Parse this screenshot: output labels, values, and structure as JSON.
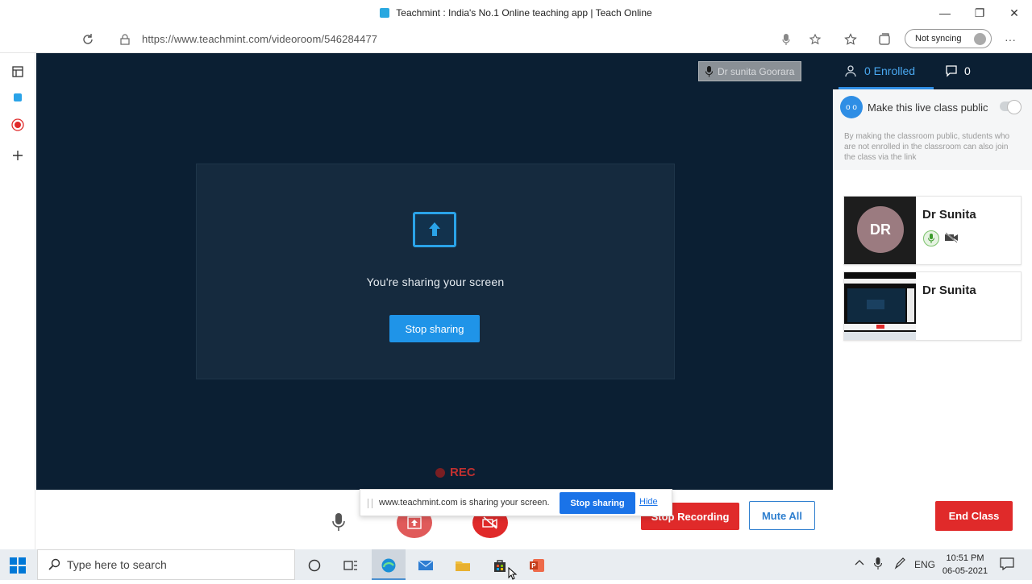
{
  "window": {
    "title": "Teachmint : India's No.1 Online teaching app | Teach Online",
    "minimize": "—",
    "maximize": "❐",
    "close": "✕"
  },
  "browser": {
    "url": "https://www.teachmint.com/videoroom/546284477",
    "sync_label": "Not syncing"
  },
  "stage": {
    "speaker_name": "Dr sunita Goorara",
    "sharing_text": "You're sharing your screen",
    "stop_sharing_label": "Stop sharing",
    "rec_label": "REC"
  },
  "panel": {
    "enrolled_label": "0 Enrolled",
    "chat_count": "0",
    "public_icon_text": "o o",
    "public_label": "Make this live class public",
    "public_desc": "By making the classroom public, students who are not enrolled in the classroom can also join the class via the link",
    "participants": [
      {
        "name": "Dr Sunita",
        "initials": "DR"
      },
      {
        "name": "Dr Sunita"
      }
    ]
  },
  "controls": {
    "stop_recording_label": "Stop Recording",
    "mute_all_label": "Mute All",
    "end_class_label": "End Class"
  },
  "share_notice": {
    "message": "www.teachmint.com is sharing your screen.",
    "stop_label": "Stop sharing",
    "hide_label": "Hide"
  },
  "taskbar": {
    "search_placeholder": "Type here to search",
    "language": "ENG",
    "time": "10:51 PM",
    "date": "06-05-2021"
  },
  "colors": {
    "stage_bg": "#0b1f33",
    "accent_blue": "#1f94e8",
    "danger_red": "#e02a2a"
  }
}
